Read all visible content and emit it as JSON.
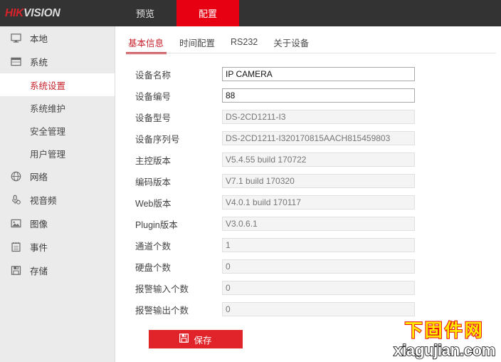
{
  "header": {
    "logo_hik": "HIK",
    "logo_vision": "VISION",
    "tabs": [
      {
        "label": "预览",
        "name": "preview",
        "active": false
      },
      {
        "label": "配置",
        "name": "configuration",
        "active": true
      }
    ],
    "accent_color": "#e60012"
  },
  "sidebar": {
    "items": [
      {
        "label": "本地",
        "icon": "monitor-icon"
      },
      {
        "label": "系统",
        "icon": "window-icon"
      }
    ],
    "sub_items": [
      {
        "label": "系统设置",
        "active": true
      },
      {
        "label": "系统维护",
        "active": false
      },
      {
        "label": "安全管理",
        "active": false
      },
      {
        "label": "用户管理",
        "active": false
      }
    ],
    "items_after": [
      {
        "label": "网络",
        "icon": "globe-icon"
      },
      {
        "label": "视音频",
        "icon": "microphone-icon"
      },
      {
        "label": "图像",
        "icon": "picture-icon"
      },
      {
        "label": "事件",
        "icon": "clipboard-icon"
      },
      {
        "label": "存储",
        "icon": "floppy-icon"
      }
    ],
    "active_color": "#c7202a"
  },
  "content": {
    "tabs": [
      {
        "label": "基本信息",
        "active": true
      },
      {
        "label": "时间配置",
        "active": false
      },
      {
        "label": "RS232",
        "active": false
      },
      {
        "label": "关于设备",
        "active": false
      }
    ],
    "fields": [
      {
        "label": "设备名称",
        "value": "IP CAMERA",
        "readonly": false
      },
      {
        "label": "设备编号",
        "value": "88",
        "readonly": false
      },
      {
        "label": "设备型号",
        "value": "DS-2CD1211-I3",
        "readonly": true
      },
      {
        "label": "设备序列号",
        "value": "DS-2CD1211-I320170815AACH815459803",
        "readonly": true
      },
      {
        "label": "主控版本",
        "value": "V5.4.55 build 170722",
        "readonly": true
      },
      {
        "label": "编码版本",
        "value": "V7.1 build 170320",
        "readonly": true
      },
      {
        "label": "Web版本",
        "value": "V4.0.1 build 170117",
        "readonly": true
      },
      {
        "label": "Plugin版本",
        "value": "V3.0.6.1",
        "readonly": true
      },
      {
        "label": "通道个数",
        "value": "1",
        "readonly": true
      },
      {
        "label": "硬盘个数",
        "value": "0",
        "readonly": true
      },
      {
        "label": "报警输入个数",
        "value": "0",
        "readonly": true
      },
      {
        "label": "报警输出个数",
        "value": "0",
        "readonly": true
      }
    ],
    "save_button": {
      "label": "保存",
      "icon": "floppy-save-icon",
      "color": "#e1232a"
    }
  },
  "watermark": {
    "line1": "下固件网",
    "line2": "xiagujian.com",
    "line1_color": "#ffe800",
    "line1_stroke": "#e8110f",
    "line2_color": "#ffffff"
  }
}
